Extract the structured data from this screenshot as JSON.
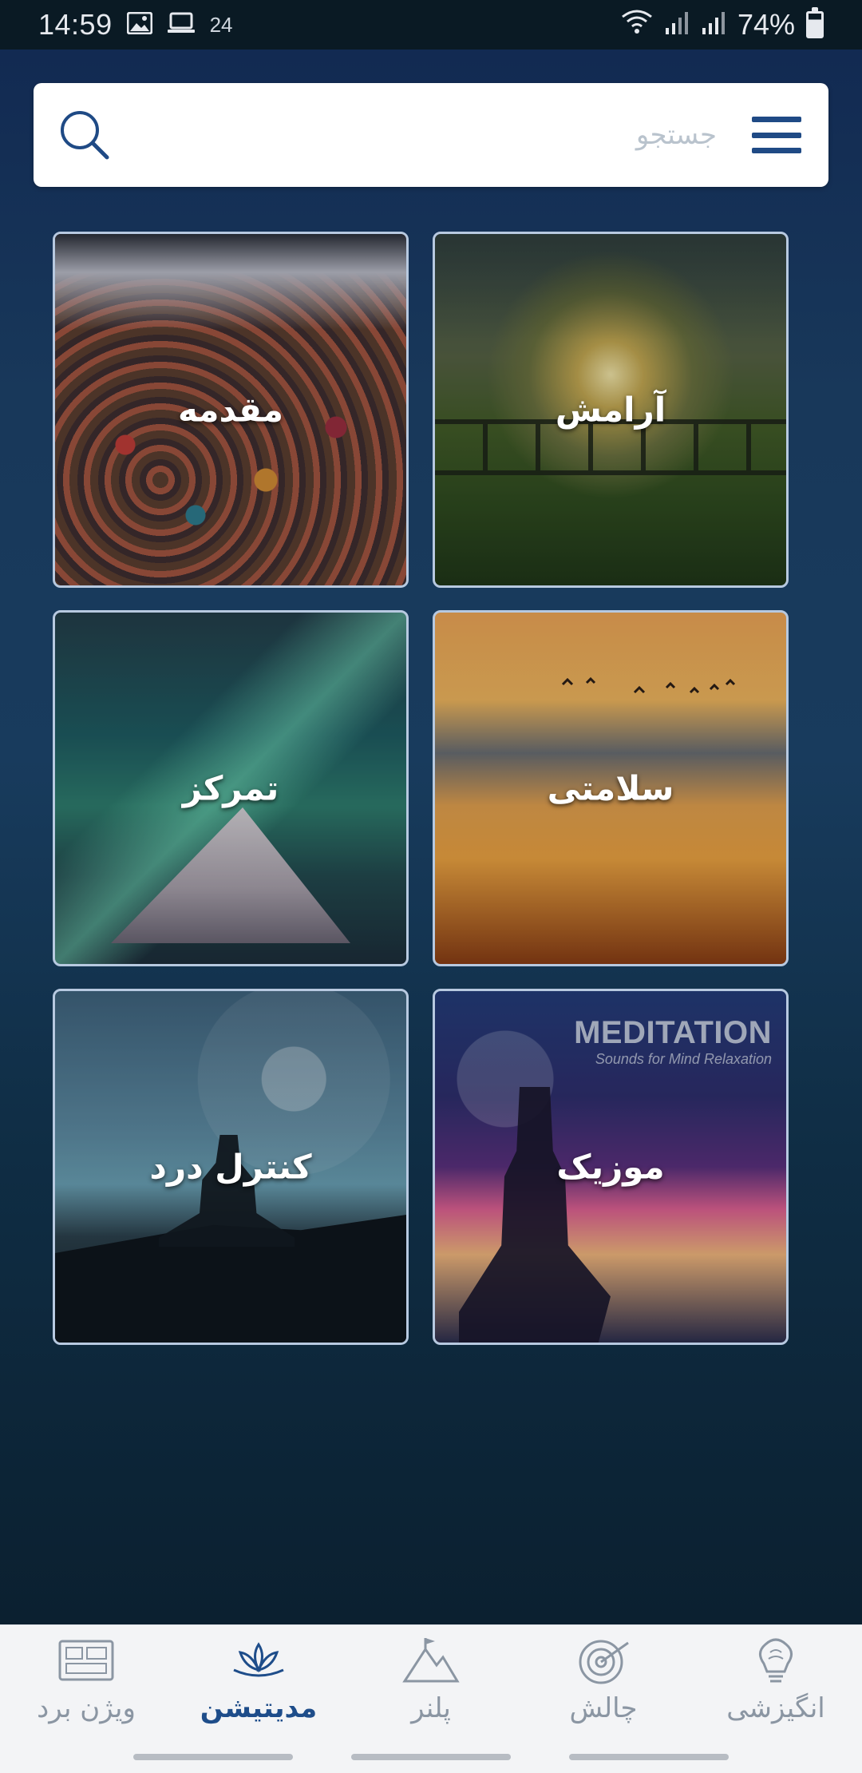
{
  "status_bar": {
    "time": "14:59",
    "notification_count": "24",
    "battery": "74%"
  },
  "search": {
    "placeholder": "جستجو",
    "value": ""
  },
  "tiles": [
    {
      "label": "آرامش",
      "image": "sunset-fence-field"
    },
    {
      "label": "مقدمه",
      "image": "colorful-pebbles-lake"
    },
    {
      "label": "سلامتی",
      "image": "orange-sea-sunset-birds"
    },
    {
      "label": "تمرکز",
      "image": "aurora-mountain"
    },
    {
      "label": "موزیک",
      "image": "meditation-woman-galaxy"
    },
    {
      "label": "کنترل درد",
      "image": "meditator-silhouette-mist"
    }
  ],
  "music_tile_brand": {
    "title": "MEDITATION",
    "subtitle": "Sounds for Mind Relaxation"
  },
  "bottom_nav": [
    {
      "label": "ویژن برد",
      "icon": "vision-board-icon",
      "active": false
    },
    {
      "label": "مدیتیشن",
      "icon": "lotus-icon",
      "active": true
    },
    {
      "label": "پلنر",
      "icon": "mountain-flag-icon",
      "active": false
    },
    {
      "label": "چالش",
      "icon": "target-icon",
      "active": false
    },
    {
      "label": "انگیزشی",
      "icon": "brain-bulb-icon",
      "active": false
    }
  ],
  "colors": {
    "accent": "#1e4d8a",
    "tile_border": "#b7c9e0",
    "nav_inactive": "#8b96a3"
  }
}
